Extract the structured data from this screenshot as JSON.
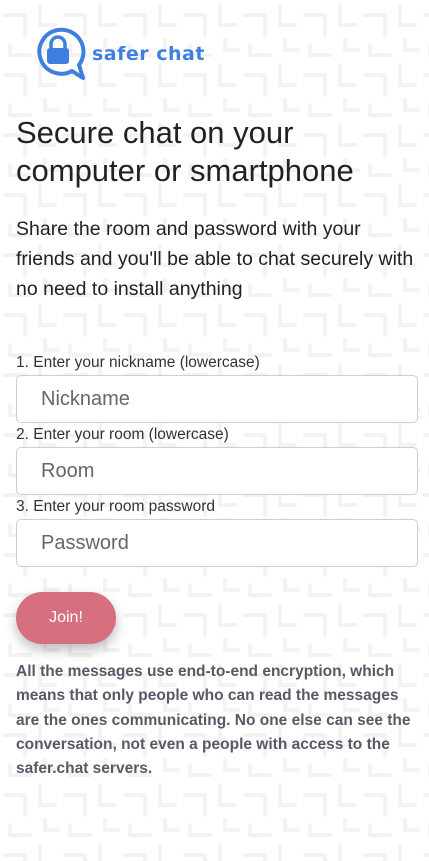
{
  "brand": {
    "name": "safer chat",
    "logo_icon": "lock-chat-bubble-icon",
    "color": "#3f7fe0"
  },
  "headline": "Secure chat on your computer or smartphone",
  "intro": "Share the room and password with your friends and you'll be able to chat securely with no need to install anything",
  "form": {
    "nickname": {
      "label": "1. Enter your nickname (lowercase)",
      "placeholder": "Nickname",
      "value": ""
    },
    "room": {
      "label": "2. Enter your room (lowercase)",
      "placeholder": "Room",
      "value": ""
    },
    "password": {
      "label": "3. Enter your room password",
      "placeholder": "Password",
      "value": ""
    },
    "join_label": "Join!",
    "join_color": "#d6707f"
  },
  "disclaimer": "All the messages use end-to-end encryption, which means that only people who can read the messages are the ones communicating. No one else can see the conversation, not even a people with access to the safer.chat servers."
}
